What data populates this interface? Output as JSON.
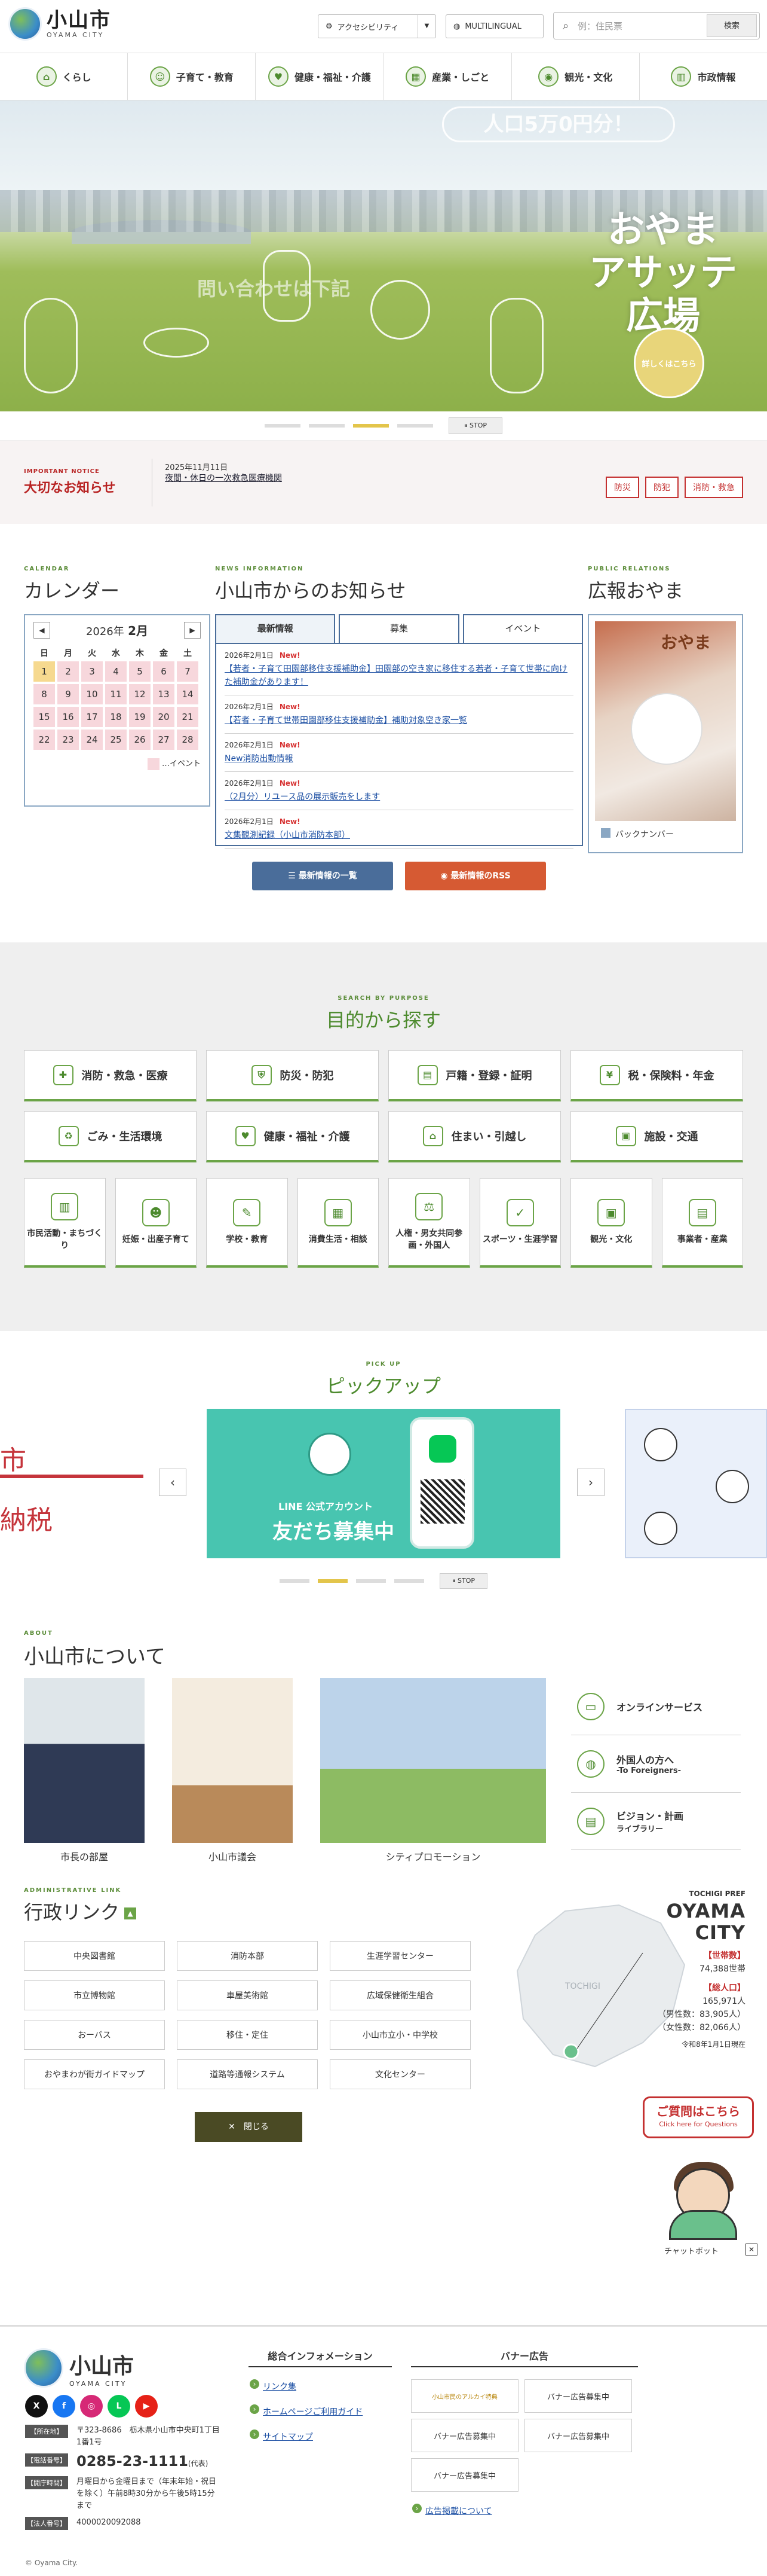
{
  "header": {
    "logo_ja": "小山市",
    "logo_en": "OYAMA CITY",
    "accessibility": "アクセシビリティ",
    "multilingual": "MULTILINGUAL",
    "search_placeholder": "例：住民票",
    "search_button": "検索"
  },
  "gnav": [
    {
      "label": "くらし",
      "icon": "house-icon"
    },
    {
      "label": "子育て・教育",
      "icon": "family-icon"
    },
    {
      "label": "健康・福祉・介護",
      "icon": "heart-icon"
    },
    {
      "label": "産業・しごと",
      "icon": "briefcase-icon"
    },
    {
      "label": "観光・文化",
      "icon": "camera-icon"
    },
    {
      "label": "市政情報",
      "icon": "city-hall-icon"
    }
  ],
  "hero": {
    "title_line1": "おやま",
    "title_line2": "アサッテ",
    "title_line3": "広場",
    "bubble": "人口5万0円分！",
    "ghost_text": "問い合わせは下記",
    "detail_button": "詳しくはこちら",
    "stop": "STOP"
  },
  "notice": {
    "en": "IMPORTANT NOTICE",
    "ja": "大切なお知らせ",
    "date": "2025年11月11日",
    "text": "夜間・休日の一次救急医療機関",
    "buttons": [
      "防災",
      "防犯",
      "消防・救急"
    ]
  },
  "calendar": {
    "en": "CALENDAR",
    "ja": "カレンダー",
    "year": "2026年",
    "month": "2月",
    "dow": [
      "日",
      "月",
      "火",
      "水",
      "木",
      "金",
      "土"
    ],
    "days": [
      "1",
      "2",
      "3",
      "4",
      "5",
      "6",
      "7",
      "8",
      "9",
      "10",
      "11",
      "12",
      "13",
      "14",
      "15",
      "16",
      "17",
      "18",
      "19",
      "20",
      "21",
      "22",
      "23",
      "24",
      "25",
      "26",
      "27",
      "28"
    ],
    "legend": "…イベント"
  },
  "news": {
    "en": "NEWS INFORMATION",
    "ja": "小山市からのお知らせ",
    "tabs": [
      "最新情報",
      "募集",
      "イベント"
    ],
    "items": [
      {
        "date": "2026年2月1日",
        "new": "New!",
        "title": "【若者・子育て田園部移住支援補助金】田園部の空き家に移住する若者・子育て世帯に向けた補助金があります！"
      },
      {
        "date": "2026年2月1日",
        "new": "New!",
        "title": "【若者・子育て世帯田園部移住支援補助金】補助対象空き家一覧"
      },
      {
        "date": "2026年2月1日",
        "new": "New!",
        "title": "New消防出動情報"
      },
      {
        "date": "2026年2月1日",
        "new": "New!",
        "title": "（2月分）リユース品の展示販売をします"
      },
      {
        "date": "2026年2月1日",
        "new": "New!",
        "title": "文集観測記録（小山市消防本部）"
      }
    ],
    "btn_list": "最新情報の一覧",
    "btn_rss": "最新情報のRSS"
  },
  "pr": {
    "en": "PUBLIC RELATIONS",
    "ja": "広報おやま",
    "cover_title": "おやま",
    "backnumber": "バックナンバー"
  },
  "purpose": {
    "en": "SEARCH BY PURPOSE",
    "ja": "目的から探す",
    "large": [
      {
        "label": "消防・救急・医療",
        "icon": "ambulance-icon"
      },
      {
        "label": "防災・防犯",
        "icon": "shield-icon"
      },
      {
        "label": "戸籍・登録・証明",
        "icon": "document-icon"
      },
      {
        "label": "税・保険料・年金",
        "icon": "yen-icon"
      },
      {
        "label": "ごみ・生活環境",
        "icon": "trash-icon"
      },
      {
        "label": "健康・福祉・介護",
        "icon": "heart-icon"
      },
      {
        "label": "住まい・引越し",
        "icon": "house-icon"
      },
      {
        "label": "施設・交通",
        "icon": "bus-icon"
      }
    ],
    "small": [
      {
        "label": "市民活動・まちづくり",
        "icon": "building-icon"
      },
      {
        "label": "妊娠・出産子育て",
        "icon": "baby-icon"
      },
      {
        "label": "学校・教育",
        "icon": "school-icon"
      },
      {
        "label": "消費生活・相談",
        "icon": "consult-icon"
      },
      {
        "label": "人権・男女共同参画・外国人",
        "icon": "scale-icon"
      },
      {
        "label": "スポーツ・生涯学習",
        "icon": "sports-icon"
      },
      {
        "label": "観光・文化",
        "icon": "camera-icon"
      },
      {
        "label": "事業者・産業",
        "icon": "briefcase-icon"
      }
    ]
  },
  "pickup": {
    "en": "PICK UP",
    "ja": "ピックアップ",
    "left_text1": "市",
    "left_text2": "納税",
    "main_label": "LINE 公式アカウント",
    "main_title": "友だち募集中",
    "stop": "STOP"
  },
  "about": {
    "en": "ABOUT",
    "ja": "小山市について",
    "cards": [
      "市長の部屋",
      "小山市議会",
      "シティプロモーション"
    ],
    "links": [
      {
        "label": "オンラインサービス",
        "sub": "",
        "icon": "monitor-icon"
      },
      {
        "label": "外国人の方へ",
        "sub": "-To Foreigners-",
        "icon": "globe-icon"
      },
      {
        "label": "ビジョン・計画",
        "sub": "ライブラリー",
        "icon": "book-icon"
      }
    ]
  },
  "admin": {
    "en": "ADMINISTRATIVE LINK",
    "ja": "行政リンク",
    "links": [
      "中央図書館",
      "消防本部",
      "生涯学習センター",
      "市立博物館",
      "車屋美術館",
      "広域保健衛生組合",
      "おーバス",
      "移住・定住",
      "小山市立小・中学校",
      "おやまわが街ガイドマップ",
      "道路等通報システム",
      "文化センター"
    ],
    "close": "閉じる"
  },
  "stats": {
    "pref": "TOCHIGI PREF",
    "city": "OYAMA CITY",
    "households_label": "【世帯数】",
    "households": "74,388世帯",
    "population_label": "【総人口】",
    "population": "165,971人",
    "male": "（男性数：83,905人）",
    "female": "（女性数：82,066人）",
    "asof": "令和8年1月1日現在",
    "map_label": "TOCHIGI"
  },
  "chatbot": {
    "question": "ご質問はこちら",
    "question_en": "Click here for Questions",
    "label": "チャットボット"
  },
  "footer": {
    "logo_ja": "小山市",
    "logo_en": "OYAMA CITY",
    "sns": [
      "X",
      "f",
      "◎",
      "L",
      "▶"
    ],
    "rows": [
      {
        "k": "【所在地】",
        "v": "〒323-8686　栃木県小山市中央町1丁目1番1号"
      },
      {
        "k": "【電話番号】",
        "v": "0285-23-1111",
        "suffix": "(代表)"
      },
      {
        "k": "【開庁時間】",
        "v": "月曜日から金曜日まで（年末年始・祝日を除く）午前8時30分から午後5時15分まで"
      },
      {
        "k": "【法人番号】",
        "v": "4000020092088"
      }
    ],
    "copyright": "© Oyama City.",
    "general_title": "総合インフォメーション",
    "general_links": [
      "リンク集",
      "ホームページご利用ガイド",
      "サイトマップ"
    ],
    "banner_title": "バナー広告",
    "banners": [
      "小山市民のアルカイ特典",
      "バナー広告募集中",
      "バナー広告募集中",
      "バナー広告募集中",
      "バナー広告募集中"
    ],
    "banner_link": "広告掲載について"
  }
}
